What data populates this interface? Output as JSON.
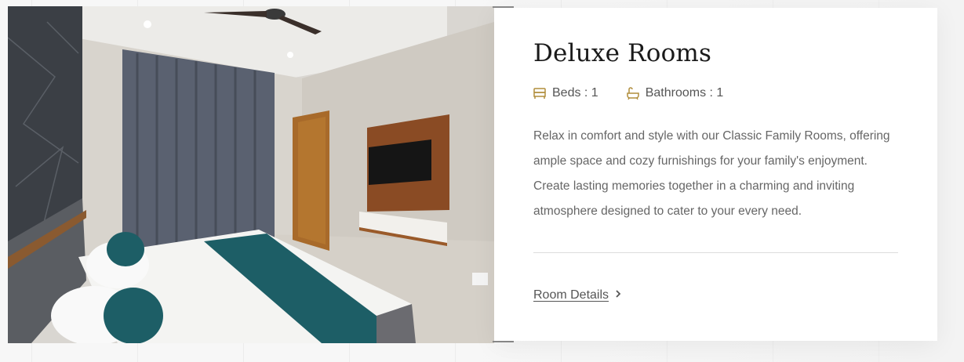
{
  "room": {
    "title": "Deluxe Rooms",
    "amenities": [
      {
        "icon": "bed-icon",
        "label": "Beds : 1"
      },
      {
        "icon": "bathtub-icon",
        "label": "Bathrooms : 1"
      }
    ],
    "description": "Relax in comfort and style with our Classic Family Rooms, offering ample space and cozy furnishings for your family's enjoyment. Create lasting memories together in a charming and inviting atmosphere designed to cater to your every need.",
    "details_link": {
      "label": "Room Details",
      "icon": "chevron-right-icon"
    }
  },
  "colors": {
    "accent_gold": "#b08d3c",
    "title": "#1a1a1a",
    "body_text": "#666666",
    "card_bg": "#ffffff",
    "page_bg": "#f7f7f7"
  }
}
